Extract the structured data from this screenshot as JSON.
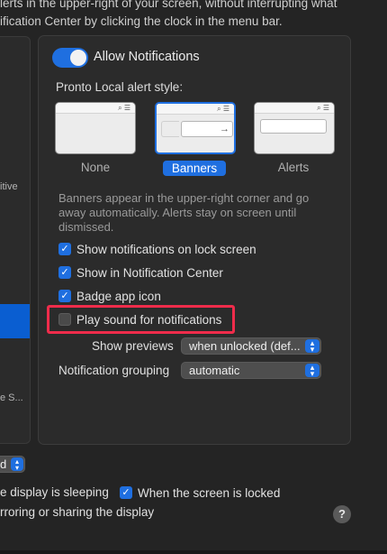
{
  "header": {
    "line1": "lerts in the upper-right of your screen, without interrupting what",
    "line2": "ification Center by clicking the clock in the menu bar."
  },
  "sidebar": {
    "frag_itive": "itive",
    "frag_es": "e S..."
  },
  "notifications": {
    "allow_label": "Allow Notifications",
    "allow_on": true,
    "style_label": "Pronto Local alert style:",
    "styles": [
      {
        "label": "None",
        "selected": false
      },
      {
        "label": "Banners",
        "selected": true
      },
      {
        "label": "Alerts",
        "selected": false
      }
    ],
    "description": "Banners appear in the upper-right corner and go away automatically. Alerts stay on screen until dismissed.",
    "checks": [
      {
        "label": "Show notifications on lock screen",
        "checked": true
      },
      {
        "label": "Show in Notification Center",
        "checked": true
      },
      {
        "label": "Badge app icon",
        "checked": true
      },
      {
        "label": "Play sound for notifications",
        "checked": false
      }
    ],
    "previews_label": "Show previews",
    "previews_value": "when unlocked (def...",
    "grouping_label": "Notification grouping",
    "grouping_value": "automatic"
  },
  "bottom": {
    "popup_value": "d",
    "sleep_text": "e display is sleeping",
    "locked_label": "When the screen is locked",
    "locked_checked": true,
    "mirror_text": "rroring or sharing the display",
    "help_label": "?"
  },
  "colors": {
    "accent": "#1f6fe0",
    "highlight": "#ef2c4b",
    "background": "#242424",
    "panel": "#2b2b2b"
  },
  "icons": {
    "check": "checkmark-icon",
    "stepper": "chevron-updown-icon",
    "help": "question-mark-icon"
  }
}
